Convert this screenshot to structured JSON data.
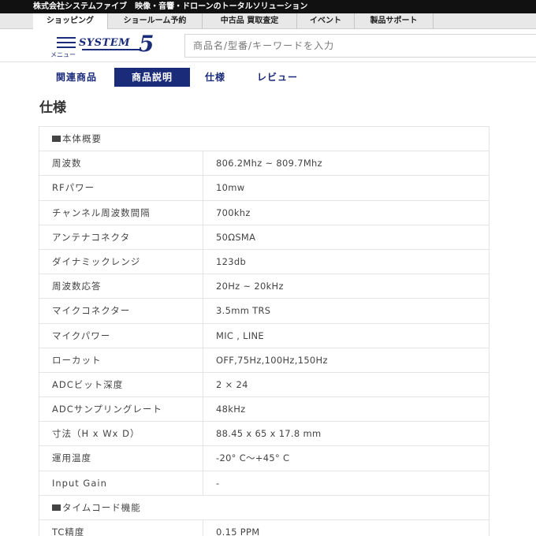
{
  "topbar": {
    "text": "株式会社システムファイブ　映像・音響・ドローンのトータルソリューション"
  },
  "nav_tabs": [
    {
      "label": "ショッピング",
      "active": true
    },
    {
      "label": "ショールーム予約",
      "active": false
    },
    {
      "label": "中古品 買取査定",
      "active": false
    },
    {
      "label": "イベント",
      "active": false
    },
    {
      "label": "製品サポート",
      "active": false
    }
  ],
  "header": {
    "menu_label": "メニュー",
    "logo_text": "SYSTEM",
    "logo_number": "5",
    "search_placeholder": "商品名/型番/キーワードを入力"
  },
  "sub_tabs": [
    {
      "label": "関連商品",
      "active": false
    },
    {
      "label": "商品説明",
      "active": true
    },
    {
      "label": "仕様",
      "active": false
    },
    {
      "label": "レビュー",
      "active": false
    }
  ],
  "section_title": "仕様",
  "colors": {
    "brand": "#1a2b7a",
    "topbar": "#111111"
  },
  "specs": [
    {
      "key": "本体概要",
      "value": "",
      "heading": true
    },
    {
      "key": "周波数",
      "value": "806.2Mhz ~ 809.7Mhz"
    },
    {
      "key": "RFパワー",
      "value": "10mw"
    },
    {
      "key": "チャンネル周波数間隔",
      "value": "700khz"
    },
    {
      "key": "アンテナコネクタ",
      "value": "50ΩSMA"
    },
    {
      "key": "ダイナミックレンジ",
      "value": "123db"
    },
    {
      "key": "周波数応答",
      "value": "20Hz ~ 20kHz"
    },
    {
      "key": "マイクコネクター",
      "value": "3.5mm TRS"
    },
    {
      "key": "マイクパワー",
      "value": "MIC , LINE"
    },
    {
      "key": "ローカット",
      "value": "OFF,75Hz,100Hz,150Hz"
    },
    {
      "key": "ADCビット深度",
      "value": "2 × 24"
    },
    {
      "key": "ADCサンプリングレート",
      "value": "48kHz"
    },
    {
      "key": "寸法（H x Wx D）",
      "value": "88.45 x 65 x 17.8 mm"
    },
    {
      "key": "運用温度",
      "value": "-20° C〜+45° C"
    },
    {
      "key": "Input Gain",
      "value": "-"
    },
    {
      "key": "タイムコード機能",
      "value": "",
      "heading": true
    },
    {
      "key": "TC精度",
      "value": "0.15 PPM"
    }
  ]
}
